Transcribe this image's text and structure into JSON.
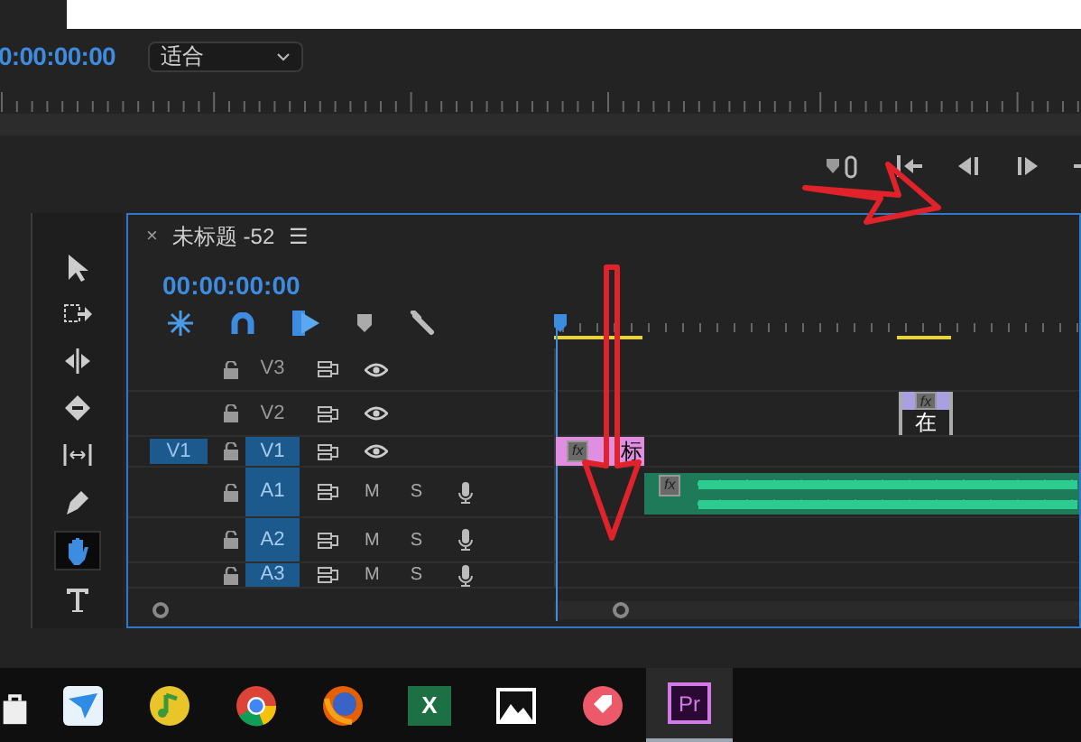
{
  "monitor": {
    "timecode": "0:00:00:00",
    "zoom_dropdown": "适合"
  },
  "tools": [
    {
      "kind": "selection",
      "selected": false
    },
    {
      "kind": "track-select",
      "selected": false
    },
    {
      "kind": "ripple",
      "selected": false
    },
    {
      "kind": "razor",
      "selected": false
    },
    {
      "kind": "slip",
      "selected": false
    },
    {
      "kind": "pen",
      "selected": false
    },
    {
      "kind": "hand",
      "selected": true
    },
    {
      "kind": "type",
      "selected": false
    }
  ],
  "timeline": {
    "close": "×",
    "title": "未标题 -52",
    "menu": "☰",
    "timecode": "00:00:00:00",
    "tracks": [
      {
        "name": "V3",
        "kind": "video",
        "targeted": false
      },
      {
        "name": "V2",
        "kind": "video",
        "targeted": false,
        "clips": [
          {
            "kind": "graphic",
            "badge": "fx",
            "label": "在"
          }
        ]
      },
      {
        "name": "V1",
        "kind": "video",
        "targeted": true,
        "source": "V1",
        "clips": [
          {
            "kind": "title",
            "badge": "fx",
            "label": "标"
          }
        ]
      },
      {
        "name": "A1",
        "kind": "audio",
        "targeted": true,
        "mute": "M",
        "solo": "S",
        "clips": [
          {
            "kind": "audio",
            "badge": "fx"
          }
        ]
      },
      {
        "name": "A2",
        "kind": "audio",
        "targeted": true,
        "mute": "M",
        "solo": "S"
      },
      {
        "name": "A3",
        "kind": "audio",
        "targeted": true,
        "mute": "M",
        "solo": "S"
      }
    ]
  },
  "taskbar": [
    {
      "kind": "store",
      "selected": false
    },
    {
      "kind": "bird",
      "selected": false
    },
    {
      "kind": "music",
      "selected": false
    },
    {
      "kind": "chrome",
      "selected": false
    },
    {
      "kind": "firefox",
      "selected": false
    },
    {
      "kind": "excel",
      "label": "X",
      "selected": false
    },
    {
      "kind": "photos",
      "selected": false
    },
    {
      "kind": "tag",
      "selected": false
    },
    {
      "kind": "premiere",
      "label": "Pr",
      "selected": true
    }
  ]
}
